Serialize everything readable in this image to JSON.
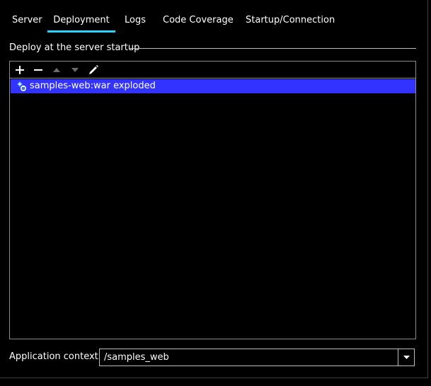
{
  "tabs": [
    {
      "label": "Server",
      "active": false
    },
    {
      "label": "Deployment",
      "active": true
    },
    {
      "label": "Logs",
      "active": false
    },
    {
      "label": "Code Coverage",
      "active": false
    },
    {
      "label": "Startup/Connection",
      "active": false
    }
  ],
  "deploy_group": {
    "title": "Deploy at the server startup",
    "toolbar": {
      "add_icon": "plus-icon",
      "remove_icon": "minus-icon",
      "move_up_icon": "arrow-up-icon",
      "move_down_icon": "arrow-down-icon",
      "edit_icon": "pencil-icon"
    },
    "items": [
      {
        "label": "samples-web:war exploded",
        "icon": "artifact-exploded-icon",
        "selected": true
      }
    ]
  },
  "app_context": {
    "label": "Application context:",
    "value": "/samples_web"
  },
  "colors": {
    "background": "#000000",
    "active_tab_underline": "#2ad3ff",
    "selection": "#3333ff",
    "border": "#8a8a8a",
    "disabled_icon": "#6b6b6b"
  }
}
